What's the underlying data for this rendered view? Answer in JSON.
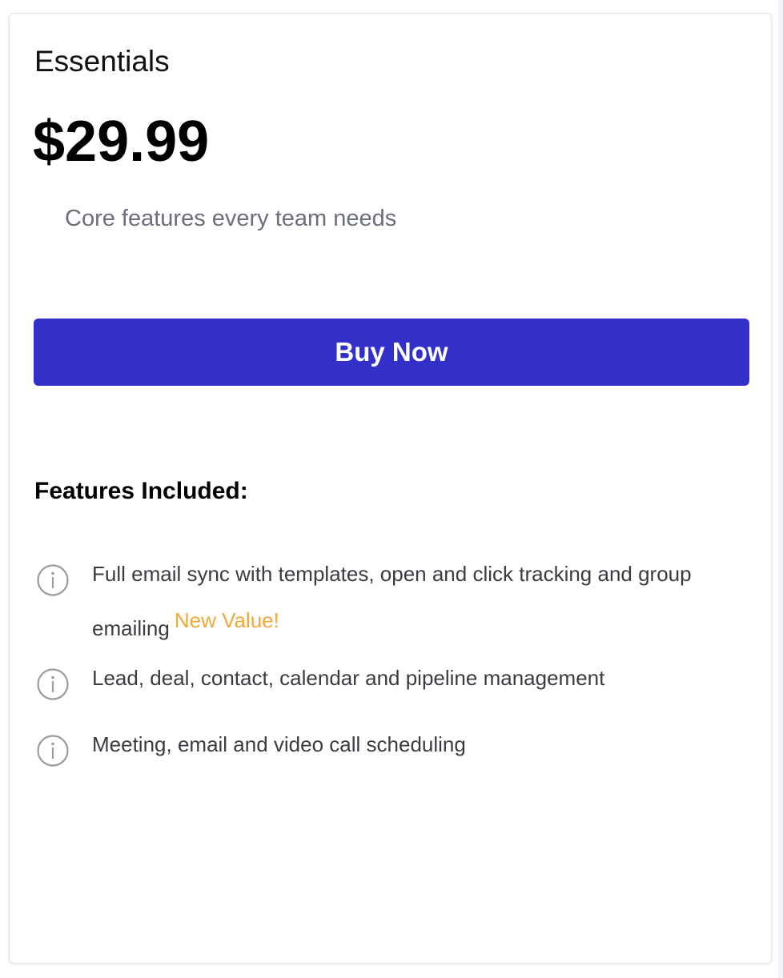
{
  "plan": {
    "name": "Essentials",
    "price": "$29.99",
    "tagline": "Core features every team needs",
    "buy_label": "Buy Now",
    "accent_color": "#3330c9"
  },
  "features": {
    "heading": "Features Included:",
    "items": [
      {
        "text": "Full email sync with templates, open and click tracking and group emailing",
        "badge": "New Value!",
        "icon": "info-icon"
      },
      {
        "text": "Lead, deal, contact, calendar and pipeline management",
        "icon": "info-icon"
      },
      {
        "text": "Meeting, email and video call scheduling",
        "icon": "info-icon"
      }
    ],
    "badge_color": "#f0a83a"
  }
}
